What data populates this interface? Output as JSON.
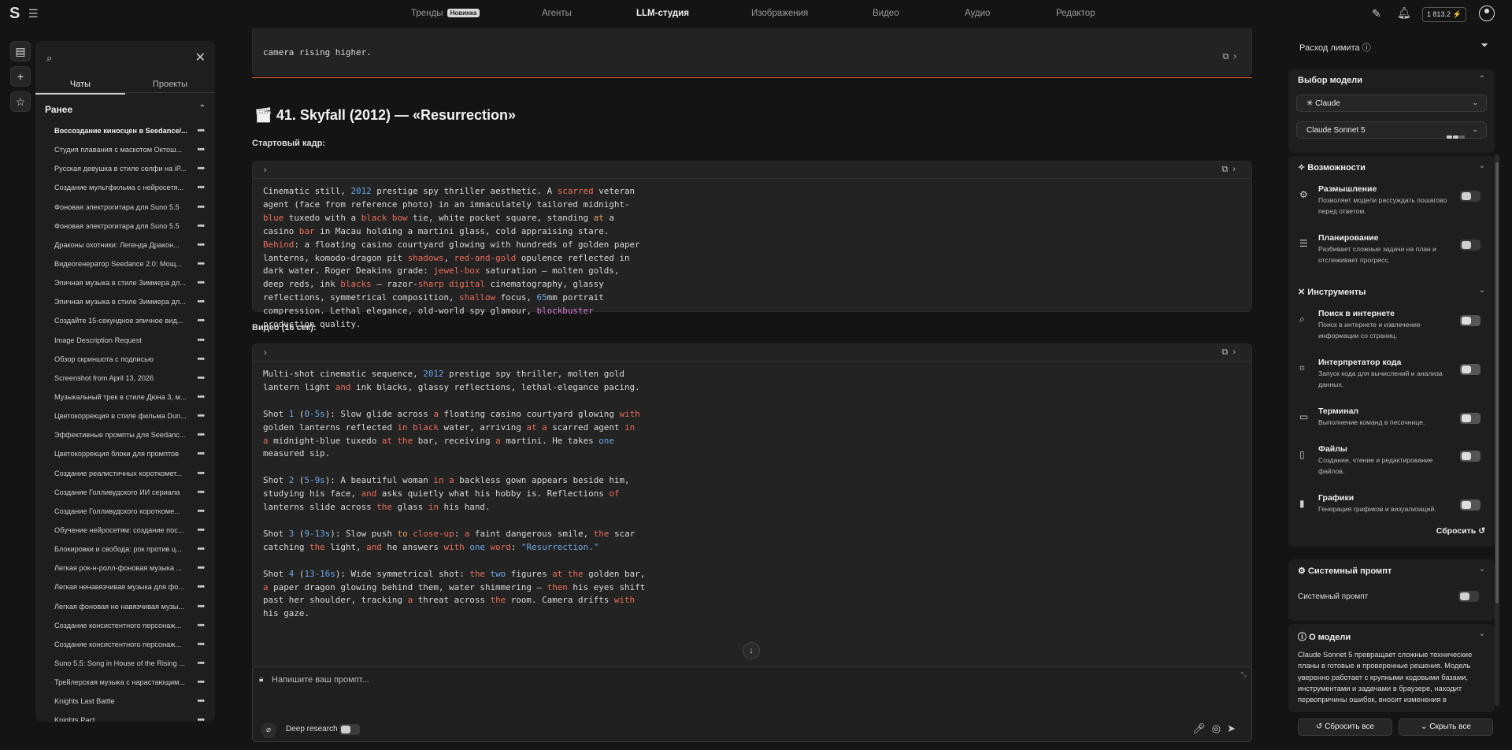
{
  "nav": {
    "items": [
      {
        "label": "Тренды",
        "badge": "Новинка"
      },
      {
        "label": "Агенты"
      },
      {
        "label": "LLM-студия",
        "active": true
      },
      {
        "label": "Изображения"
      },
      {
        "label": "Видео"
      },
      {
        "label": "Аудио"
      },
      {
        "label": "Редактор"
      }
    ],
    "credits": "1 813.2"
  },
  "sidebar": {
    "tabs": [
      "Чаты",
      "Проекты"
    ],
    "section": "Ранее",
    "chats": [
      "Воссоздание киносцен в Seedance/...",
      "Студия плавания с маскотом Октош...",
      "Русская девушка в стиле селфи на iP...",
      "Создание мультфильма с нейросетя...",
      "Фоновая электрогитара для Suno 5.5",
      "Фоновая электрогитара для Suno 5.5",
      "Драконы охотники: Легенда Дракон...",
      "Видеогенератор Seedance 2.0: Мощ...",
      "Эпичная музыка в стиле Зиммера дл...",
      "Эпичная музыка в стиле Зиммера дл...",
      "Создайте 15-секундное эпичное вид...",
      "Image Description Request",
      "Обзор скриншота с подписью",
      "Screenshot from April 13, 2026",
      "Музыкальный трек в стиле Дюна 3, м...",
      "Цветокоррекция в стиле фильма Dun...",
      "Эффективные промпты для Seedanc...",
      "Цветокоррекция блоки для промптов",
      "Создание реалистичных короткомет...",
      "Создание Голливудского ИИ сериала",
      "Создание Голливудского короткоме...",
      "Обучение нейросетям: создание пос...",
      "Блокировки и свобода: рок против ц...",
      "Легкая рок-н-ролл-фоновая музыка ...",
      "Легкая ненавязчивая музыка для фо...",
      "Легкая фоновая не навязчивая музы...",
      "Создание консистентного персонаж...",
      "Создание консистентного персонаж...",
      "Suno 5.5: Song in House of the Rising ...",
      "Трейлерская музыка с нарастающим...",
      "Knights Last Battle",
      "Knights Pact"
    ]
  },
  "main": {
    "prev_tail": "camera rising higher.",
    "heading": "41. Skyfall (2012) — «Resurrection»",
    "start_frame_label": "Стартовый кадр:",
    "video_label": "Видео (16 сек):"
  },
  "prompt": {
    "placeholder": "Напишите ваш промпт...",
    "deep_research": "Deep research"
  },
  "right_panel": {
    "limit_title": "Расход лимита",
    "model_section": "Выбор модели",
    "provider": "Claude",
    "model": "Claude Sonnet 5",
    "capabilities_title": "Возможности",
    "capabilities": [
      {
        "name": "Размышление",
        "desc": "Позволяет модели рассуждать пошагово перед ответом."
      },
      {
        "name": "Планирование",
        "desc": "Разбивает сложные задачи на план и отслеживает прогресс."
      }
    ],
    "tools_title": "Инструменты",
    "tools": [
      {
        "name": "Поиск в интернете",
        "desc": "Поиск в интернете и извлечение информации со страниц."
      },
      {
        "name": "Интерпретатор кода",
        "desc": "Запуск кода для вычислений и анализа данных."
      },
      {
        "name": "Терминал",
        "desc": "Выполнение команд в песочнице."
      },
      {
        "name": "Файлы",
        "desc": "Создание, чтение и редактирование файлов."
      },
      {
        "name": "Графики",
        "desc": "Генерация графиков и визуализаций."
      }
    ],
    "reset_label": "Сбросить",
    "system_prompt_title": "Системный промпт",
    "system_prompt_label": "Системный промпт",
    "about_title": "О модели",
    "about_text": "Claude Sonnet 5 превращает сложные технические планы в готовые и проверенные решения. Модель уверенно работает с крупными кодовыми базами, инструментами и задачами в браузере, находит первопричины ошибок, вносит изменения в",
    "reset_all": "Сбросить все",
    "collapse_all": "Скрыть все"
  }
}
